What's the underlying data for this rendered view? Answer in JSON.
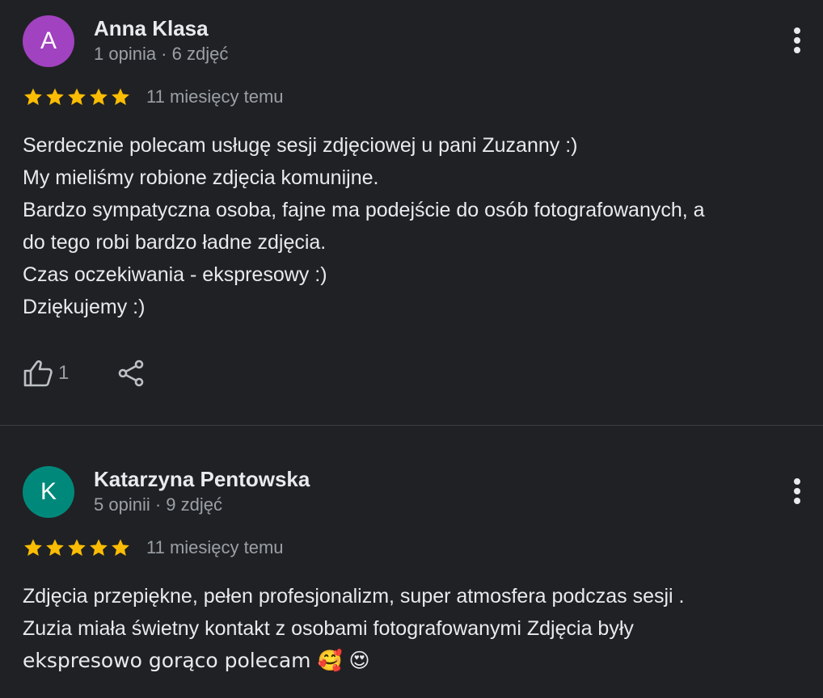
{
  "colors": {
    "background": "#202124",
    "star": "#fbbc04",
    "text_primary": "#e8eaed",
    "text_secondary": "#9aa0a6",
    "divider": "#3c4043"
  },
  "reviews": [
    {
      "avatar_letter": "A",
      "avatar_color": "#a142c0",
      "author": "Anna Klasa",
      "meta": "1 opinia · 6 zdjęć",
      "rating": 5,
      "time": "11 miesięcy temu",
      "lines": [
        "Serdecznie polecam usługę sesji zdjęciowej u pani Zuzanny :)",
        "My mieliśmy robione zdjęcia komunijne.",
        "Bardzo sympatyczna osoba, fajne ma podejście do osób fotografowanych, a",
        "do tego robi bardzo ładne zdjęcia.",
        "Czas oczekiwania - ekspresowy :)",
        "Dziękujemy :)"
      ],
      "likes": "1",
      "like_icon": "thumbs-up-icon",
      "share_icon": "share-icon",
      "more_icon": "more-vert-icon"
    },
    {
      "avatar_letter": "K",
      "avatar_color": "#00897b",
      "author": "Katarzyna Pentowska",
      "meta": "5 opinii · 9 zdjęć",
      "rating": 5,
      "time": "11 miesięcy temu",
      "lines": [
        "Zdjęcia przepiękne, pełen profesjonalizm, super atmosfera podczas sesji .",
        "Zuzia miała świetny kontakt z osobami fotografowanymi Zdjęcia były",
        "ekspresowo gorąco polecam 🥰 😍"
      ],
      "more_icon": "more-vert-icon"
    }
  ]
}
